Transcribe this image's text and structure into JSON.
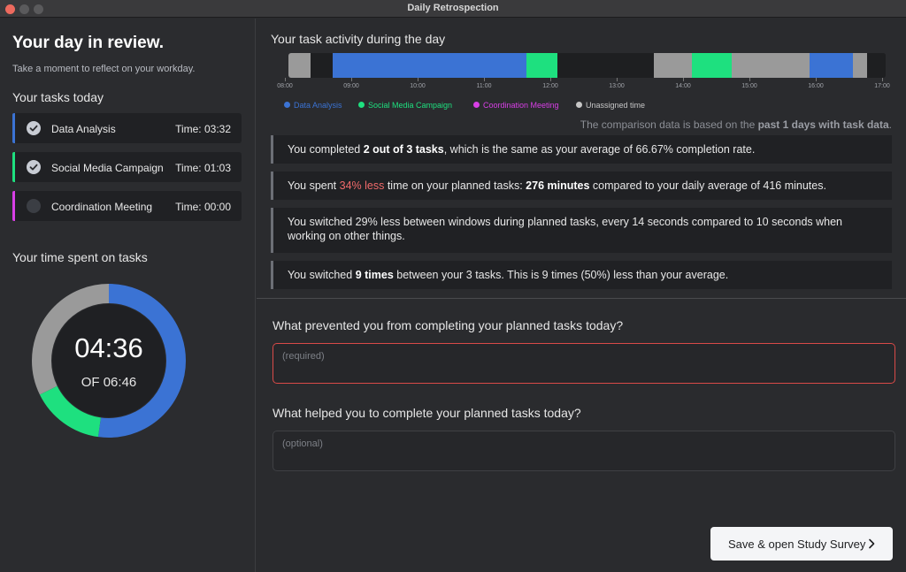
{
  "window": {
    "title": "Daily Retrospection"
  },
  "sidebar": {
    "heading": "Your day in review.",
    "subtext": "Take a moment to reflect on your workday.",
    "tasks_title": "Your tasks today",
    "tasks": [
      {
        "name": "Data Analysis",
        "time": "Time: 03:32",
        "color": "#3b73d4",
        "checked": true
      },
      {
        "name": "Social Media Campaign",
        "time": "Time: 01:03",
        "color": "#1ee07f",
        "checked": true
      },
      {
        "name": "Coordination Meeting",
        "time": "Time: 00:00",
        "color": "#d83fe6",
        "checked": false
      }
    ],
    "time_title": "Your time spent on tasks",
    "donut": {
      "value": "04:36",
      "of_label": "OF 06:46",
      "segments": [
        {
          "label": "Data Analysis",
          "fraction": 0.522,
          "color": "#3b73d4"
        },
        {
          "label": "Social Media Campaign",
          "fraction": 0.155,
          "color": "#1ee07f"
        },
        {
          "label": "Unassigned time",
          "fraction": 0.323,
          "color": "#9a9a9a"
        }
      ]
    }
  },
  "activity": {
    "title": "Your task activity during the day",
    "ticks": [
      "08:00",
      "09:00",
      "10:00",
      "11:00",
      "12:00",
      "13:00",
      "14:00",
      "15:00",
      "16:00",
      "17:00"
    ],
    "timeline": [
      {
        "from": "08:00",
        "to": "08:20",
        "type": "unassigned"
      },
      {
        "from": "08:20",
        "to": "08:40",
        "type": "none"
      },
      {
        "from": "08:40",
        "to": "11:35",
        "type": "data_analysis"
      },
      {
        "from": "11:35",
        "to": "12:03",
        "type": "social_media"
      },
      {
        "from": "12:03",
        "to": "13:30",
        "type": "none"
      },
      {
        "from": "13:30",
        "to": "14:05",
        "type": "unassigned"
      },
      {
        "from": "14:05",
        "to": "14:41",
        "type": "social_media"
      },
      {
        "from": "14:41",
        "to": "15:51",
        "type": "unassigned"
      },
      {
        "from": "15:51",
        "to": "16:30",
        "type": "data_analysis"
      },
      {
        "from": "16:30",
        "to": "16:43",
        "type": "unassigned"
      },
      {
        "from": "16:43",
        "to": "17:00",
        "type": "none"
      }
    ],
    "colors": {
      "data_analysis": "#3b73d4",
      "social_media": "#1ee07f",
      "coordination": "#d83fe6",
      "unassigned": "#9a9a9a",
      "none": "#1e1f21"
    },
    "legend": [
      {
        "label": "Data Analysis",
        "color": "#3b73d4"
      },
      {
        "label": "Social Media Campaign",
        "color": "#1ee07f"
      },
      {
        "label": "Coordination Meeting",
        "color": "#d83fe6"
      },
      {
        "label": "Unassigned time",
        "color": "#c6c6c6"
      }
    ],
    "comparison_note": {
      "prefix": "The comparison data is based on the ",
      "bold": "past 1 days with task data",
      "suffix": "."
    }
  },
  "stats": {
    "s1": {
      "a": "You completed ",
      "b": "2 out of 3 tasks",
      "c": ", which is the same as your average of 66.67% completion rate."
    },
    "s2": {
      "a": "You spent ",
      "red": "34% less",
      "b": " time on your planned tasks: ",
      "bold": "276 minutes",
      "c": " compared to your daily average of 416 minutes."
    },
    "s3": {
      "text": "You switched 29% less between windows during planned tasks, every 14 seconds compared to 10 seconds when working on other things."
    },
    "s4": {
      "a": "You switched ",
      "bold": "9 times",
      "b": " between your 3 tasks. This is  9  times  (50%) less  than your average."
    }
  },
  "questions": {
    "q1": {
      "label": "What prevented you from completing your planned tasks today?",
      "placeholder": "(required)"
    },
    "q2": {
      "label": "What helped you to complete your planned tasks today?",
      "placeholder": "(optional)"
    }
  },
  "footer": {
    "save_label": "Save & open Study Survey"
  }
}
